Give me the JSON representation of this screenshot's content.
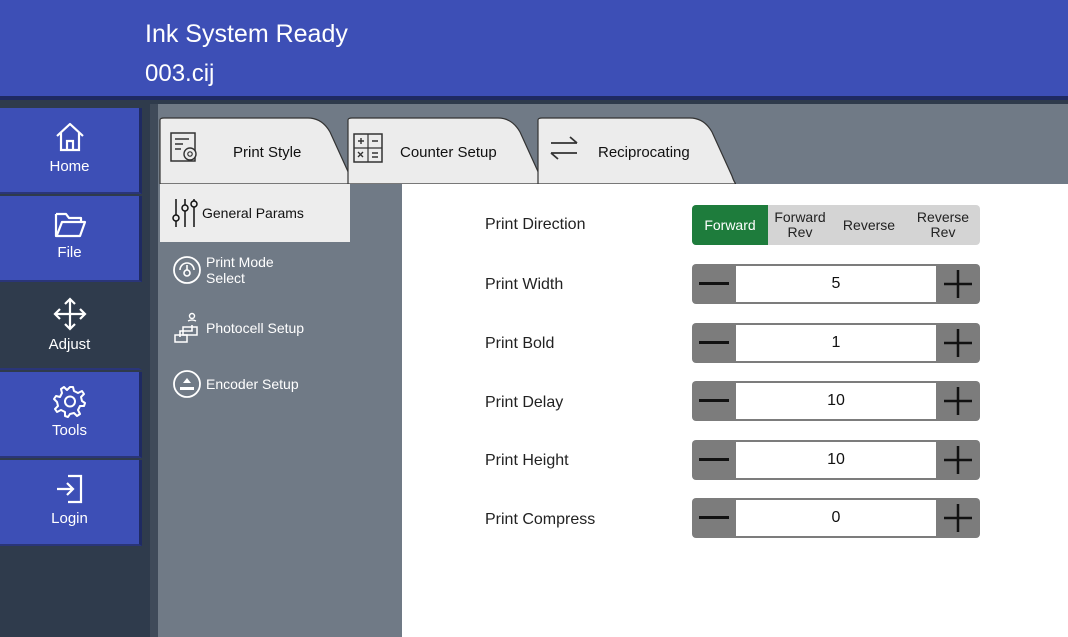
{
  "header": {
    "status": "Ink System Ready",
    "file_name": "003.cij"
  },
  "nav": {
    "items": [
      {
        "label": "Home",
        "icon": "home-icon"
      },
      {
        "label": "File",
        "icon": "folder-icon"
      },
      {
        "label": "Adjust",
        "icon": "move-arrows-icon"
      },
      {
        "label": "Tools",
        "icon": "gear-icon"
      },
      {
        "label": "Login",
        "icon": "login-icon"
      }
    ],
    "active": "Adjust"
  },
  "tabs": [
    {
      "label": "Print Style",
      "icon": "print-style-icon"
    },
    {
      "label": "Counter Setup",
      "icon": "calculator-icon"
    },
    {
      "label": "Reciprocating",
      "icon": "swap-arrows-icon"
    }
  ],
  "submenu": {
    "items": [
      {
        "label": "General Params",
        "icon": "sliders-icon"
      },
      {
        "label_line1": "Print Mode",
        "label_line2": "Select",
        "icon": "print-mode-icon"
      },
      {
        "label": "Photocell Setup",
        "icon": "photocell-icon"
      },
      {
        "label": "Encoder Setup",
        "icon": "encoder-icon"
      }
    ]
  },
  "params": {
    "direction": {
      "label": "Print Direction",
      "options": [
        {
          "line1": "Forward",
          "line2": ""
        },
        {
          "line1": "Forward",
          "line2": "Rev"
        },
        {
          "line1": "Reverse",
          "line2": ""
        },
        {
          "line1": "Reverse",
          "line2": "Rev"
        }
      ],
      "selected": "Forward"
    },
    "width": {
      "label": "Print Width",
      "value": "5"
    },
    "bold": {
      "label": "Print Bold",
      "value": "1"
    },
    "delay": {
      "label": "Print Delay",
      "value": "10"
    },
    "height": {
      "label": "Print Height",
      "value": "10"
    },
    "compress": {
      "label": "Print Compress",
      "value": "0"
    }
  },
  "colors": {
    "header_bg": "#3d4fb6",
    "content_bg": "#707a86",
    "selected_green": "#1e7c3c",
    "stepper_gray": "#7c7c7c"
  }
}
